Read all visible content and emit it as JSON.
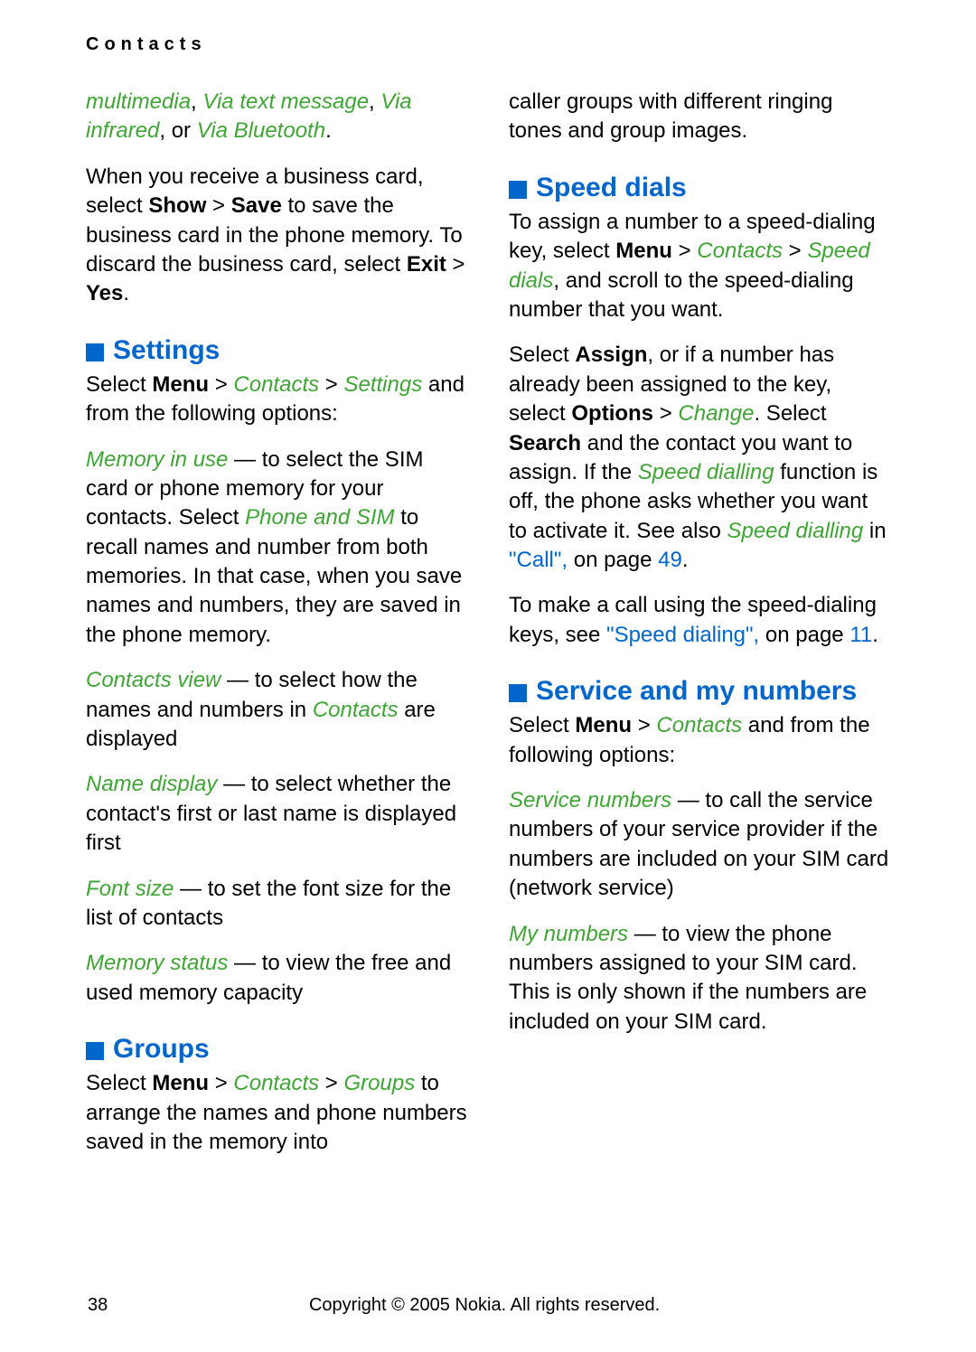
{
  "header": "Contacts",
  "left": {
    "p1": {
      "a": "multimedia",
      "b": ", ",
      "c": "Via text message",
      "d": ", ",
      "e": "Via infrared",
      "f": ", or ",
      "g": "Via Bluetooth",
      "h": "."
    },
    "p2": {
      "a": "When you receive a business card, select ",
      "b": "Show",
      "c": " > ",
      "d": "Save",
      "e": " to save the business card in the phone memory. To discard the business card, select ",
      "f": "Exit",
      "g": " > ",
      "h": "Yes",
      "i": "."
    },
    "h_settings": "Settings",
    "p3": {
      "a": "Select ",
      "b": "Menu",
      "c": " > ",
      "d": "Contacts",
      "e": " > ",
      "f": "Settings",
      "g": " and from the following options:"
    },
    "p4": {
      "a": "Memory in use",
      "b": " — to select the SIM card or phone memory for your contacts. Select ",
      "c": "Phone and SIM",
      "d": " to recall names and number from both memories. In that case, when you save names and numbers, they are saved in the phone memory."
    },
    "p5": {
      "a": "Contacts view",
      "b": " — to select how the names and numbers in ",
      "c": "Contacts",
      "d": " are displayed"
    },
    "p6": {
      "a": "Name display",
      "b": " — to select whether the contact's first or last name is displayed first"
    },
    "p7": {
      "a": "Font size",
      "b": " — to set the font size for the list of contacts"
    },
    "p8": {
      "a": "Memory status",
      "b": " — to view the free and used memory capacity"
    },
    "h_groups": "Groups",
    "p9": {
      "a": "Select ",
      "b": "Menu",
      "c": " > ",
      "d": "Contacts",
      "e": " > ",
      "f": "Groups",
      "g": " to arrange the names and phone numbers saved in the memory into"
    }
  },
  "right": {
    "p1": "caller groups with different ringing tones and group images.",
    "h_speed": "Speed dials",
    "p2": {
      "a": "To assign a number to a speed-dialing key, select ",
      "b": "Menu",
      "c": " > ",
      "d": "Contacts",
      "e": " > ",
      "f": "Speed dials",
      "g": ", and scroll to the speed-dialing number that you want."
    },
    "p3": {
      "a": "Select ",
      "b": "Assign",
      "c": ", or if a number has already been assigned to the key, select ",
      "d": "Options",
      "e": " > ",
      "f": "Change",
      "g": ". Select ",
      "h": "Search",
      "i": " and the contact you want to assign. If the ",
      "j": "Speed dialling",
      "k": " function is off, the phone asks whether you want to activate it. See also ",
      "l": "Speed dialling",
      "m": " in ",
      "n": "\"Call\",",
      "o": " on page ",
      "p": "49",
      "q": "."
    },
    "p4": {
      "a": "To make a call using the speed-dialing keys, see ",
      "b": "\"Speed dialing\",",
      "c": " on page ",
      "d": "11",
      "e": "."
    },
    "h_service": "Service and my numbers",
    "p5": {
      "a": "Select ",
      "b": "Menu",
      "c": " > ",
      "d": "Contacts",
      "e": " and from the following options:"
    },
    "p6": {
      "a": "Service numbers",
      "b": " — to call the service numbers of your service provider if the numbers are included on your SIM card (network service)"
    },
    "p7": {
      "a": "My numbers",
      "b": " — to view the phone numbers assigned to your SIM card. This is only shown if the numbers are included on your SIM card."
    }
  },
  "footer": {
    "page": "38",
    "copy": "Copyright © 2005 Nokia. All rights reserved."
  }
}
